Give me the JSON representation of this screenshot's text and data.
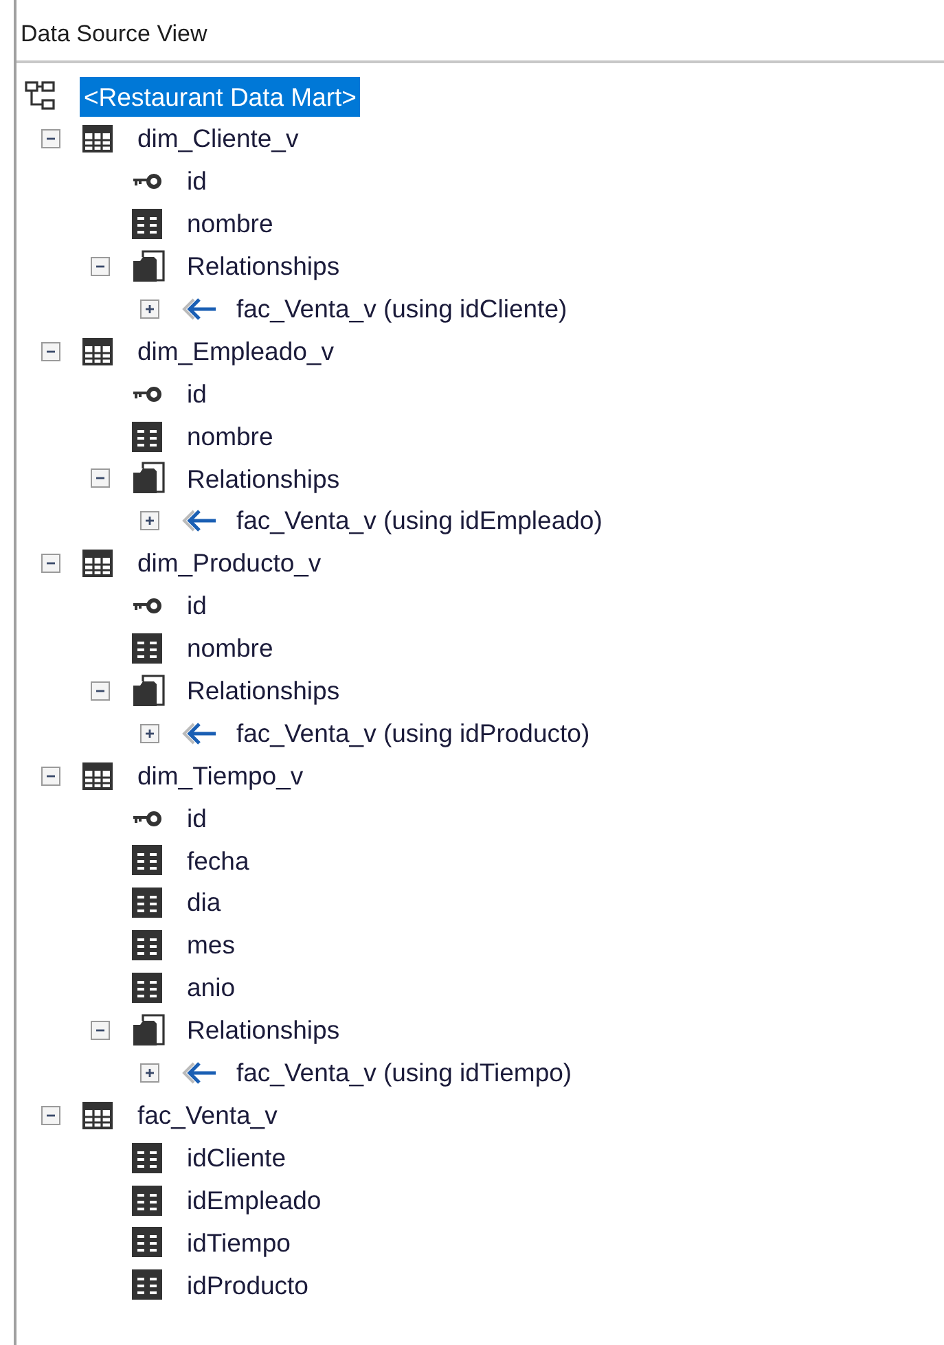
{
  "panel": {
    "title": "Data Source View"
  },
  "tree": {
    "root": {
      "label": "<Restaurant Data Mart>",
      "selected": true
    },
    "nodes": [
      {
        "kind": "table",
        "label": "dim_Cliente_v",
        "expanded": true,
        "children": [
          {
            "kind": "key",
            "label": "id"
          },
          {
            "kind": "column",
            "label": "nombre"
          },
          {
            "kind": "relationships",
            "label": "Relationships",
            "expanded": true,
            "children": [
              {
                "kind": "relation",
                "label": "fac_Venta_v (using idCliente)",
                "expanded": false
              }
            ]
          }
        ]
      },
      {
        "kind": "table",
        "label": "dim_Empleado_v",
        "expanded": true,
        "children": [
          {
            "kind": "key",
            "label": "id"
          },
          {
            "kind": "column",
            "label": "nombre"
          },
          {
            "kind": "relationships",
            "label": "Relationships",
            "expanded": true,
            "children": [
              {
                "kind": "relation",
                "label": "fac_Venta_v (using idEmpleado)",
                "expanded": false
              }
            ]
          }
        ]
      },
      {
        "kind": "table",
        "label": "dim_Producto_v",
        "expanded": true,
        "children": [
          {
            "kind": "key",
            "label": "id"
          },
          {
            "kind": "column",
            "label": "nombre"
          },
          {
            "kind": "relationships",
            "label": "Relationships",
            "expanded": true,
            "children": [
              {
                "kind": "relation",
                "label": "fac_Venta_v (using idProducto)",
                "expanded": false
              }
            ]
          }
        ]
      },
      {
        "kind": "table",
        "label": "dim_Tiempo_v",
        "expanded": true,
        "children": [
          {
            "kind": "key",
            "label": "id"
          },
          {
            "kind": "column",
            "label": "fecha"
          },
          {
            "kind": "column",
            "label": "dia"
          },
          {
            "kind": "column",
            "label": "mes"
          },
          {
            "kind": "column",
            "label": "anio"
          },
          {
            "kind": "relationships",
            "label": "Relationships",
            "expanded": true,
            "children": [
              {
                "kind": "relation",
                "label": "fac_Venta_v (using idTiempo)",
                "expanded": false
              }
            ]
          }
        ]
      },
      {
        "kind": "table",
        "label": "fac_Venta_v",
        "expanded": true,
        "children": [
          {
            "kind": "column",
            "label": "idCliente"
          },
          {
            "kind": "column",
            "label": "idEmpleado"
          },
          {
            "kind": "column",
            "label": "idTiempo"
          },
          {
            "kind": "column",
            "label": "idProducto"
          }
        ]
      }
    ]
  }
}
